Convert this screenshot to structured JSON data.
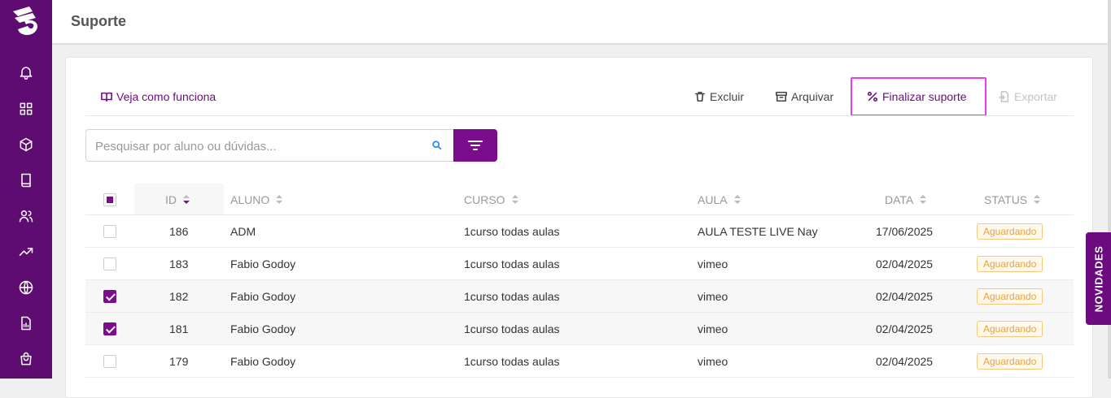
{
  "page": {
    "title": "Suporte"
  },
  "sidebar": {
    "items": [
      {
        "icon": "bell-icon"
      },
      {
        "icon": "grid-icon"
      },
      {
        "icon": "box-icon"
      },
      {
        "icon": "book-icon"
      },
      {
        "icon": "users-icon"
      },
      {
        "icon": "trending-up-icon"
      },
      {
        "icon": "globe-icon"
      },
      {
        "icon": "report-icon"
      },
      {
        "icon": "shopping-bag-icon"
      }
    ]
  },
  "toolbar": {
    "help_label": "Veja como funciona",
    "delete_label": "Excluir",
    "archive_label": "Arquivar",
    "finalize_label": "Finalizar suporte",
    "export_label": "Exportar"
  },
  "search": {
    "placeholder": "Pesquisar por aluno ou dúvidas..."
  },
  "table": {
    "headers": {
      "id": "ID",
      "student": "ALUNO",
      "course": "CURSO",
      "lesson": "AULA",
      "date": "DATA",
      "status": "STATUS"
    },
    "rows": [
      {
        "checked": false,
        "id": "186",
        "student": "ADM",
        "course": "1curso todas aulas",
        "lesson": "AULA TESTE LIVE Nay",
        "date": "17/06/2025",
        "status": "Aguardando"
      },
      {
        "checked": false,
        "id": "183",
        "student": "Fabio Godoy",
        "course": "1curso todas aulas",
        "lesson": "vimeo",
        "date": "02/04/2025",
        "status": "Aguardando"
      },
      {
        "checked": true,
        "id": "182",
        "student": "Fabio Godoy",
        "course": "1curso todas aulas",
        "lesson": "vimeo",
        "date": "02/04/2025",
        "status": "Aguardando"
      },
      {
        "checked": true,
        "id": "181",
        "student": "Fabio Godoy",
        "course": "1curso todas aulas",
        "lesson": "vimeo",
        "date": "02/04/2025",
        "status": "Aguardando"
      },
      {
        "checked": false,
        "id": "179",
        "student": "Fabio Godoy",
        "course": "1curso todas aulas",
        "lesson": "vimeo",
        "date": "02/04/2025",
        "status": "Aguardando"
      }
    ]
  },
  "side_tab": {
    "label": "NOVIDADES"
  },
  "colors": {
    "brand": "#7a0d8c",
    "sidebar": "#5e0b72",
    "status_pending": "#e8a33b",
    "highlight": "#e83ee8"
  }
}
